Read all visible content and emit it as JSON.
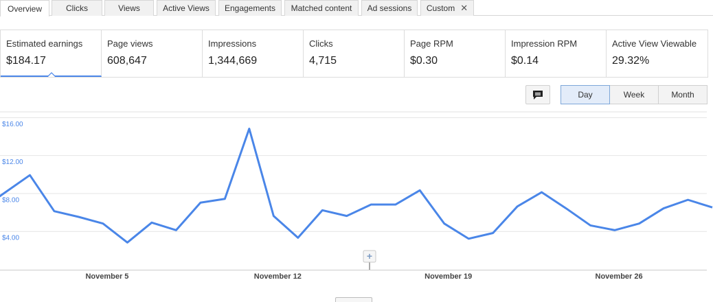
{
  "tabs": [
    {
      "label": "Overview",
      "active": true
    },
    {
      "label": "Clicks"
    },
    {
      "label": "Views"
    },
    {
      "label": "Active Views"
    },
    {
      "label": "Engagements"
    },
    {
      "label": "Matched content"
    },
    {
      "label": "Ad sessions"
    },
    {
      "label": "Custom",
      "closable": true
    }
  ],
  "metrics": [
    {
      "label": "Estimated earnings",
      "value": "$184.17",
      "active": true
    },
    {
      "label": "Page views",
      "value": "608,647"
    },
    {
      "label": "Impressions",
      "value": "1,344,669"
    },
    {
      "label": "Clicks",
      "value": "4,715"
    },
    {
      "label": "Page RPM",
      "value": "$0.30"
    },
    {
      "label": "Impression RPM",
      "value": "$0.14"
    },
    {
      "label": "Active View Viewable",
      "value": "29.32%"
    }
  ],
  "toolbar": {
    "annotation_icon": "comment-icon",
    "periods": [
      "Day",
      "Week",
      "Month"
    ],
    "selected_period": "Day",
    "annotation_add": "+"
  },
  "colors": {
    "line": "#4a86e8",
    "accent": "#4a86e8"
  },
  "chart_data": {
    "type": "line",
    "title": "",
    "xlabel": "",
    "ylabel": "",
    "ylim": [
      0,
      16.5
    ],
    "y_ticks": [
      "$4.00",
      "$8.00",
      "$12.00",
      "$16.00"
    ],
    "x_tick_labels": [
      "November 5",
      "November 12",
      "November 19",
      "November 26"
    ],
    "x_tick_day_index": [
      5,
      12,
      19,
      26
    ],
    "x_days": [
      1,
      2,
      3,
      4,
      5,
      6,
      7,
      8,
      9,
      10,
      11,
      12,
      13,
      14,
      15,
      16,
      17,
      18,
      19,
      20,
      21,
      22,
      23,
      24,
      25,
      26,
      27,
      28,
      29,
      30
    ],
    "series": [
      {
        "values": [
          7.7,
          9.9,
          6.1,
          5.5,
          4.8,
          2.8,
          4.9,
          4.1,
          7.0,
          7.4,
          14.8,
          5.6,
          3.3,
          6.2,
          5.6,
          6.8,
          6.8,
          8.3,
          4.8,
          3.2,
          3.8,
          6.6,
          8.1,
          6.4,
          4.6,
          4.1,
          4.8,
          6.4,
          7.3,
          6.5
        ]
      }
    ],
    "grid": true,
    "legend": "none"
  }
}
